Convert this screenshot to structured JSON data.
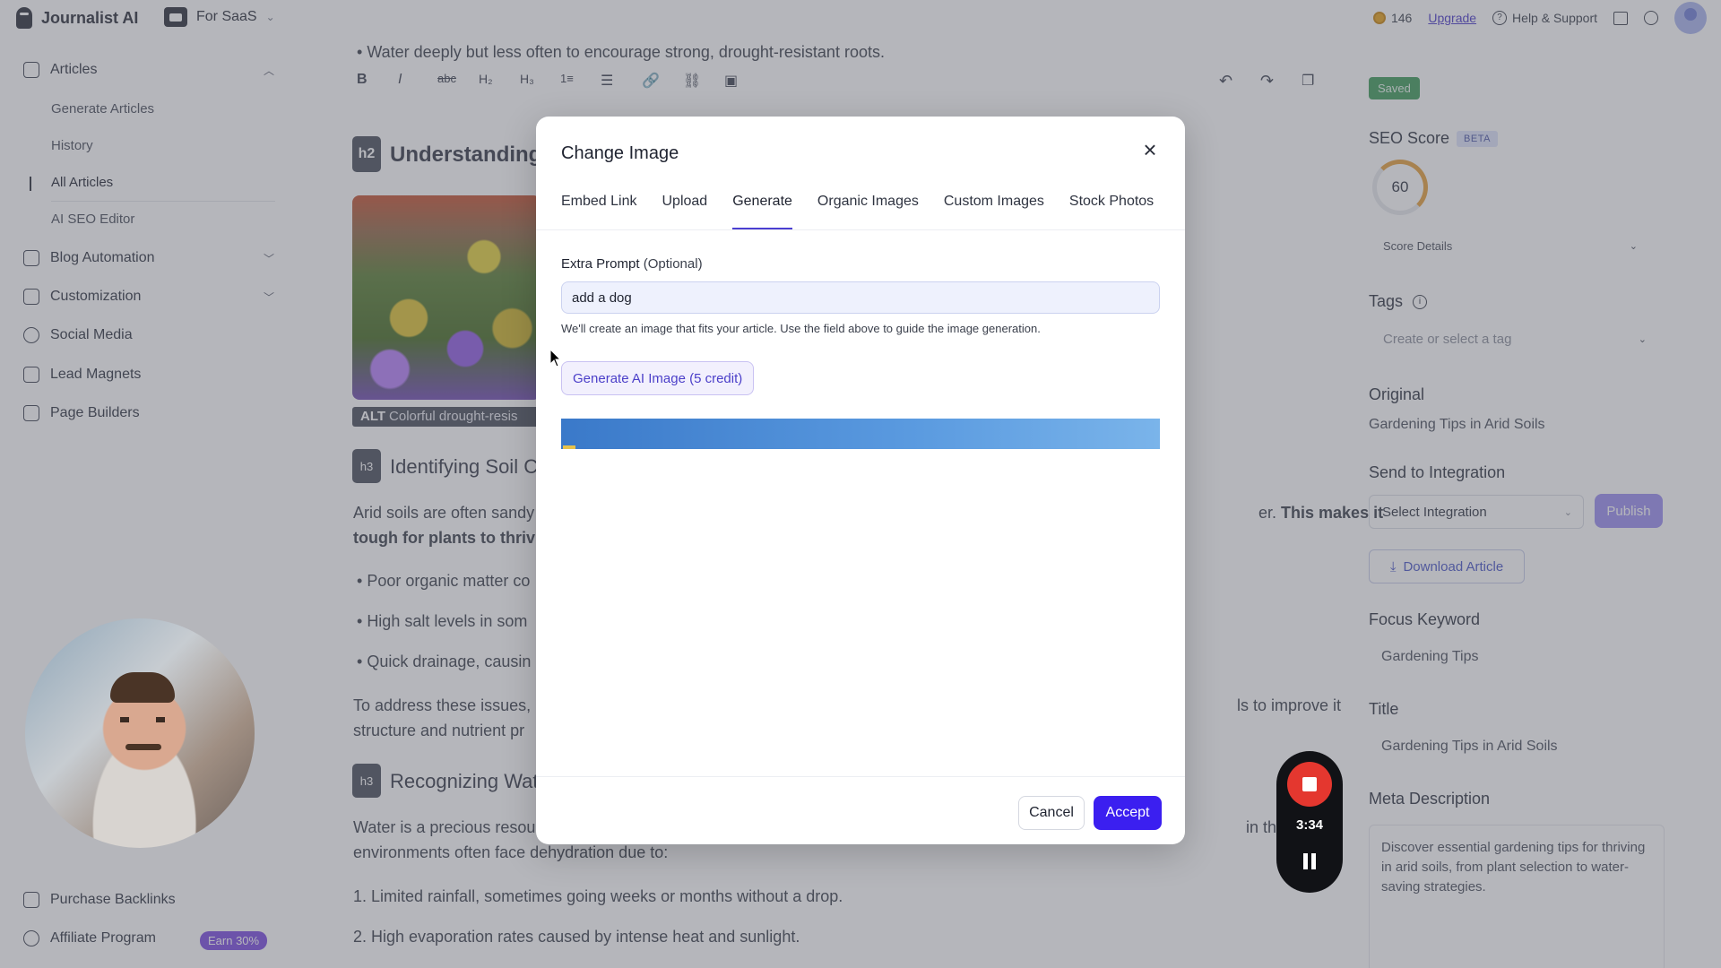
{
  "topbar": {
    "brand": "Journalist AI",
    "workspace": "For SaaS",
    "credits": "146",
    "upgrade": "Upgrade",
    "help": "Help & Support"
  },
  "sidebar": {
    "articles": "Articles",
    "generate_articles": "Generate Articles",
    "history": "History",
    "all_articles": "All Articles",
    "ai_seo_editor": "AI SEO Editor",
    "blog_automation": "Blog Automation",
    "customization": "Customization",
    "social_media": "Social Media",
    "lead_magnets": "Lead Magnets",
    "page_builders": "Page Builders",
    "purchase_backlinks": "Purchase Backlinks",
    "affiliate_program": "Affiliate Program",
    "earn_badge": "Earn 30%"
  },
  "editor": {
    "toolbar": {
      "bold": "B",
      "italic": "I",
      "h2": "H₂",
      "h3": "H₃"
    },
    "top_bullet": "Water deeply but less often to encourage strong, drought-resistant roots.",
    "h2_badge": "h2",
    "h2_heading": "Understanding",
    "alt_label": "ALT",
    "alt_text": "Colorful drought-resis",
    "h3_badge": "h3",
    "h3_heading_1": "Identifying Soil Co",
    "para1_line1_left": "Arid soils are often sandy",
    "para1_line1_right": "er.",
    "para1_line1_bold": "This makes it",
    "para1_line2": "tough for plants to thriv",
    "bullets": [
      "Poor organic matter co",
      "High salt levels in som",
      "Quick drainage, causin"
    ],
    "para2_line1_left": "To address these issues,",
    "para2_line1_right": "ls to improve it",
    "para2_line2": "structure and nutrient pr",
    "h3_heading_2": "Recognizing Wate",
    "para3_line1_left": "Water is a precious resou",
    "para3_line1_right": "in these",
    "para3_line2": "environments often face dehydration due to:",
    "list": [
      "1. Limited rainfall, sometimes going weeks or months without a drop.",
      "2. High evaporation rates caused by intense heat and sunlight."
    ]
  },
  "rpanel": {
    "saved": "Saved",
    "seo_score_label": "SEO Score",
    "beta": "BETA",
    "score": "60",
    "score_details": "Score Details",
    "tags_label": "Tags",
    "tags_placeholder": "Create or select a tag",
    "original_label": "Original",
    "original_value": "Gardening Tips in Arid Soils",
    "send_label": "Send to Integration",
    "select_integration": "Select Integration",
    "publish": "Publish",
    "download": "Download Article",
    "focus_label": "Focus Keyword",
    "focus_value": "Gardening Tips",
    "title_label": "Title",
    "title_value": "Gardening Tips in Arid Soils",
    "meta_label": "Meta Description",
    "meta_value": "Discover essential gardening tips for thriving in arid soils, from plant selection to water-saving strategies."
  },
  "modal": {
    "title": "Change Image",
    "tabs": [
      "Embed Link",
      "Upload",
      "Generate",
      "Organic Images",
      "Custom Images",
      "Stock Photos"
    ],
    "active_tab": "Generate",
    "field_label": "Extra Prompt",
    "field_optional": "(Optional)",
    "prompt_value": "add a dog",
    "helper": "We'll create an image that fits your article. Use the field above to guide the image generation.",
    "generate_button": "Generate AI Image (5 credit)",
    "cancel": "Cancel",
    "accept": "Accept"
  },
  "recorder": {
    "time": "3:34"
  },
  "icons": [
    "journalist-logo-icon",
    "folder-icon",
    "coin-icon",
    "help-icon",
    "gift-icon",
    "user-icon",
    "close-icon",
    "stop-icon",
    "pause-icon",
    "download-icon",
    "info-icon"
  ],
  "colors": {
    "accent": "#3b1ff0",
    "active_tab": "#4b3fd1",
    "saved": "#3f9b5a",
    "publish": "#9b8ef0",
    "recorder_stop": "#e4372f"
  }
}
